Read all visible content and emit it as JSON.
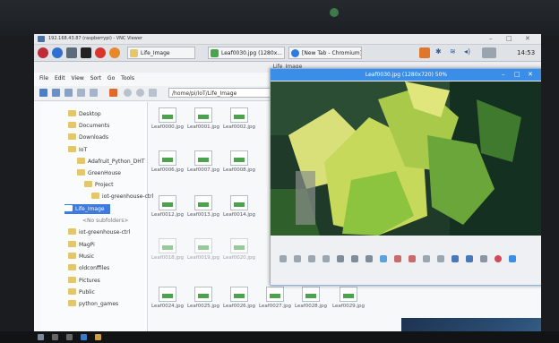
{
  "vnc": {
    "title": "192.168.43.87 (raspberrypi) - VNC Viewer",
    "min": "–",
    "max": "□",
    "close": "✕"
  },
  "taskbar": {
    "buttons": [
      {
        "label": "Life_Image"
      },
      {
        "label": "Leaf0030.jpg (1280x..."
      },
      {
        "label": "[New Tab - Chromium]"
      }
    ],
    "clock": "14:53"
  },
  "fm": {
    "title": "Life_Image",
    "menu": [
      "File",
      "Edit",
      "View",
      "Sort",
      "Go",
      "Tools"
    ],
    "path": "/home/pi/IoT/Life_Image",
    "tree": [
      {
        "label": "Desktop"
      },
      {
        "label": "Documents"
      },
      {
        "label": "Downloads"
      },
      {
        "label": "IoT"
      },
      {
        "label": "Adafruit_Python_DHT"
      },
      {
        "label": "GreenHouse"
      },
      {
        "label": "Project"
      },
      {
        "label": "iot-greenhouse-ctrl"
      },
      {
        "label": "Life_Image"
      },
      {
        "label": "<No subfolders>"
      },
      {
        "label": "iot-greenhouse-ctrl"
      },
      {
        "label": "MagPi"
      },
      {
        "label": "Music"
      },
      {
        "label": "oldconffiles"
      },
      {
        "label": "Pictures"
      },
      {
        "label": "Public"
      },
      {
        "label": "python_games"
      }
    ],
    "files": [
      "Leaf0000.jpg",
      "Leaf0001.jpg",
      "Leaf0002.jpg",
      "Leaf0006.jpg",
      "Leaf0007.jpg",
      "Leaf0008.jpg",
      "Leaf0012.jpg",
      "Leaf0013.jpg",
      "Leaf0014.jpg",
      "Leaf0018.jpg",
      "Leaf0019.jpg",
      "Leaf0020.jpg",
      "Leaf0024.jpg",
      "Leaf0025.jpg",
      "Leaf0026.jpg",
      "Leaf0027.jpg",
      "Leaf0028.jpg",
      "Leaf0029.jpg"
    ]
  },
  "viewer": {
    "title": "Leaf0030.jpg (1280x720) 50%",
    "min": "–",
    "max": "□",
    "close": "✕"
  },
  "colors": {
    "accent": "#3b8ee8",
    "selection": "#3d7be0"
  }
}
